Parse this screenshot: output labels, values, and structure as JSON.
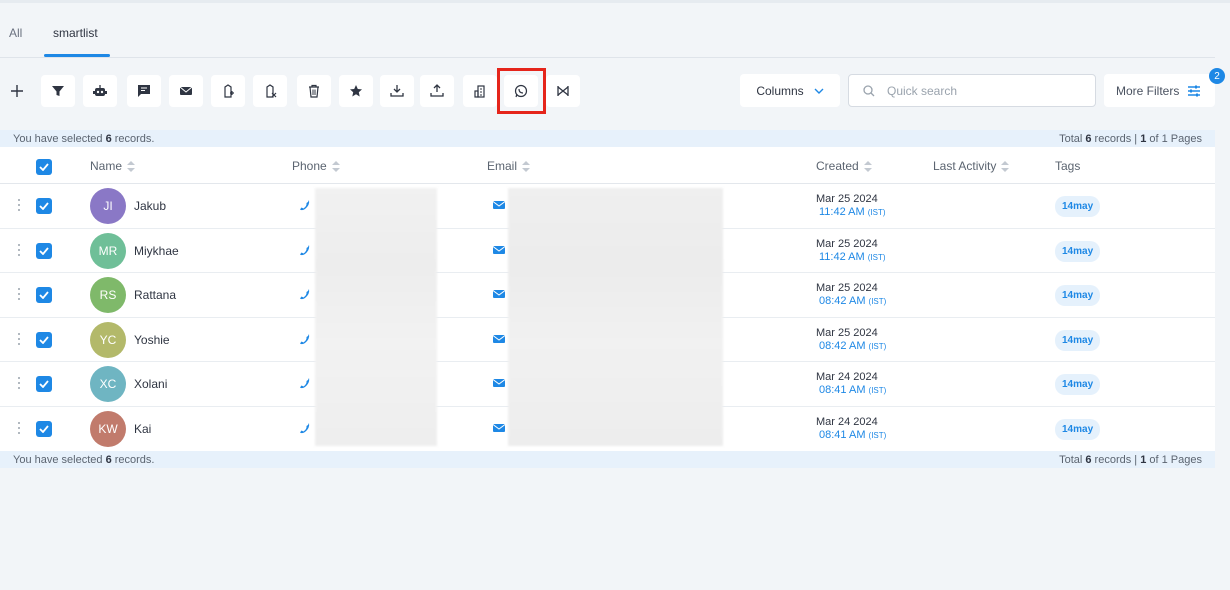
{
  "tabs": [
    {
      "label": "All"
    },
    {
      "label": "smartlist"
    }
  ],
  "toolbar": {
    "buttons": [
      {
        "name": "add-button",
        "icon": "plus-icon"
      },
      {
        "name": "filter-button",
        "icon": "funnel-icon"
      },
      {
        "name": "automation-button",
        "icon": "robot-icon"
      },
      {
        "name": "sms-button",
        "icon": "message-icon"
      },
      {
        "name": "email-button",
        "icon": "envelope-icon"
      },
      {
        "name": "add-tag-button",
        "icon": "tag-add-icon"
      },
      {
        "name": "remove-tag-button",
        "icon": "tag-remove-icon"
      },
      {
        "name": "delete-button",
        "icon": "trash-icon"
      },
      {
        "name": "review-request-button",
        "icon": "star-icon"
      },
      {
        "name": "import-button",
        "icon": "download-icon"
      },
      {
        "name": "export-button",
        "icon": "upload-icon"
      },
      {
        "name": "company-button",
        "icon": "building-icon"
      },
      {
        "name": "whatsapp-button",
        "icon": "whatsapp-icon",
        "highlighted": true
      },
      {
        "name": "merge-button",
        "icon": "merge-icon"
      }
    ],
    "columns_label": "Columns",
    "search_placeholder": "Quick search",
    "more_filters_label": "More Filters",
    "filter_count": "2",
    "highlight_color": "#e5251b"
  },
  "info_top": {
    "selected_prefix": "You have selected ",
    "selected_count": "6",
    "selected_suffix": " records.",
    "total_prefix": "Total ",
    "total_count": "6",
    "total_mid": " records | ",
    "page_current": "1",
    "page_suffix": " of 1 Pages"
  },
  "info_bottom": {
    "selected_prefix": "You have selected ",
    "selected_count": "6",
    "selected_suffix": " records.",
    "total_prefix": "Total ",
    "total_count": "6",
    "total_mid": " records | ",
    "page_current": "1",
    "page_suffix": " of 1 Pages"
  },
  "table": {
    "headers": {
      "name": "Name",
      "phone": "Phone",
      "email": "Email",
      "created": "Created",
      "last_activity": "Last Activity",
      "tags": "Tags"
    },
    "rows": [
      {
        "initials": "JI",
        "name": "Jakub",
        "avatar_color": "#8a78c6",
        "date": "Mar 25 2024",
        "time": "11:42 AM",
        "tz": "(IST)",
        "tag": "14may"
      },
      {
        "initials": "MR",
        "name": "Miykhae",
        "avatar_color": "#6fbf98",
        "date": "Mar 25 2024",
        "time": "11:42 AM",
        "tz": "(IST)",
        "tag": "14may"
      },
      {
        "initials": "RS",
        "name": "Rattana",
        "avatar_color": "#7fb96a",
        "date": "Mar 25 2024",
        "time": "08:42 AM",
        "tz": "(IST)",
        "tag": "14may"
      },
      {
        "initials": "YC",
        "name": "Yoshie",
        "avatar_color": "#b3b96a",
        "date": "Mar 25 2024",
        "time": "08:42 AM",
        "tz": "(IST)",
        "tag": "14may"
      },
      {
        "initials": "XC",
        "name": "Xolani",
        "avatar_color": "#6fb5c2",
        "date": "Mar 24 2024",
        "time": "08:41 AM",
        "tz": "(IST)",
        "tag": "14may"
      },
      {
        "initials": "KW",
        "name": "Kai",
        "avatar_color": "#c17b6c",
        "date": "Mar 24 2024",
        "time": "08:41 AM",
        "tz": "(IST)",
        "tag": "14may"
      }
    ]
  },
  "colors": {
    "accent": "#1e88e5",
    "background": "#f2f5f8"
  }
}
